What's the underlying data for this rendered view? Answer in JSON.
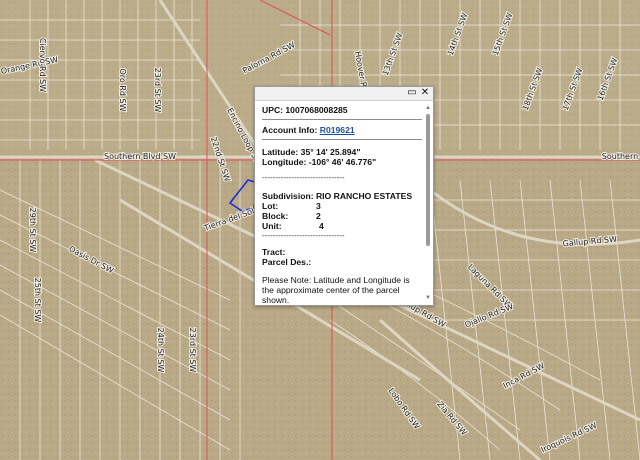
{
  "map": {
    "streets": [
      {
        "id": "southern-blvd-w",
        "text": "Southern Blvd SW"
      },
      {
        "id": "southern-blvd-e",
        "text": "Southern"
      },
      {
        "id": "encino-loop",
        "text": "Encino Loop SW"
      },
      {
        "id": "22nd-st",
        "text": "22nd St SW"
      },
      {
        "id": "tierra-del-sol",
        "text": "Tierra del Sol"
      },
      {
        "id": "23rd-st-left",
        "text": "23rd St SW"
      },
      {
        "id": "23rd-st-mid",
        "text": "23rd St SW"
      },
      {
        "id": "24th-st",
        "text": "24th St SW"
      },
      {
        "id": "25th-st",
        "text": "25th St SW"
      },
      {
        "id": "oasis-dr",
        "text": "Oasis Dr SW"
      },
      {
        "id": "gallup-rd",
        "text": "Gallup Rd SW"
      },
      {
        "id": "gallup-rd-2",
        "text": "Gallup Rd SW"
      },
      {
        "id": "laguna-rd",
        "text": "Laguna Rd SW"
      },
      {
        "id": "ojallo-rd",
        "text": "Ojallo Rd SW"
      },
      {
        "id": "17th-st",
        "text": "17th St SW"
      },
      {
        "id": "18th-st",
        "text": "18th St SW"
      },
      {
        "id": "16th-st",
        "text": "16th St SW"
      },
      {
        "id": "15th-st",
        "text": "15th St SW"
      },
      {
        "id": "14th-st",
        "text": "14th St SW"
      },
      {
        "id": "13th-st",
        "text": "13th St SW"
      },
      {
        "id": "hoover-rd",
        "text": "Hoover Rd SW"
      },
      {
        "id": "inca-rd",
        "text": "Inca Rd SW"
      },
      {
        "id": "iroquois-rd",
        "text": "Iroquois Rd SW"
      },
      {
        "id": "lobo-rd",
        "text": "Lobo Rd SW"
      },
      {
        "id": "29th-st",
        "text": "29th St SW"
      },
      {
        "id": "orange-rd",
        "text": "Orange Rd SW"
      },
      {
        "id": "paloma-rd",
        "text": "Paloma Rd SW"
      },
      {
        "id": "zia-rd",
        "text": "Zia Rd SW"
      },
      {
        "id": "ciervo-rd",
        "text": "Ciervo Rd SW"
      },
      {
        "id": "oro-rd",
        "text": "Oro Rd SW"
      }
    ]
  },
  "popup": {
    "upc_label": "UPC:",
    "upc_value": "1007068008285",
    "account_label": "Account Info:",
    "account_link": "R019621",
    "lat_label": "Latitude:",
    "lat_value": "35° 14' 25.894\"",
    "lon_label": "Longitude:",
    "lon_value": "-106° 46' 46.776\"",
    "separator": "-------------------------------",
    "subdivision_label": "Subdivision:",
    "subdivision_value": "RIO RANCHO ESTATES",
    "lot_label": "Lot:",
    "lot_value": "3",
    "block_label": "Block:",
    "block_value": "2",
    "unit_label": "Unit:",
    "unit_value": "4",
    "separator2": "-------------------------------",
    "tract_label": "Tract:",
    "parcel_label": "Parcel Des.:",
    "note": "Please Note: Latitude and Longitude is the approximate center of the parcel shown.",
    "controls": {
      "maximize": "▭",
      "close": "✕"
    }
  },
  "colors": {
    "terrain": "#b8a888",
    "parcel_line": "#f4f1ea",
    "boundary": "#e05050",
    "highlight": "#1a2fd6",
    "road": "#d9d0bc"
  }
}
